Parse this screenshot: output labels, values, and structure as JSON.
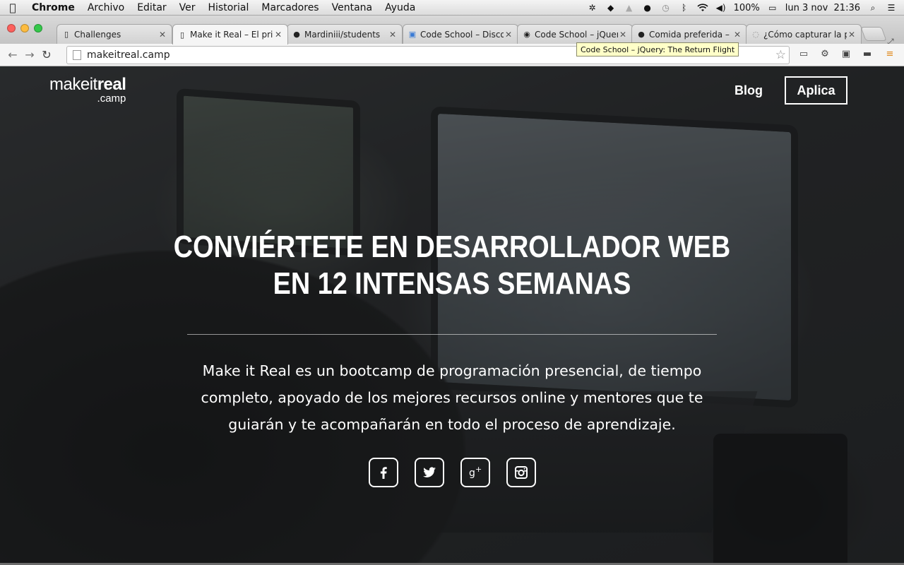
{
  "menubar": {
    "app": "Chrome",
    "items": [
      "Archivo",
      "Editar",
      "Ver",
      "Historial",
      "Marcadores",
      "Ventana",
      "Ayuda"
    ],
    "battery": "100%",
    "datetime": "lun 3 nov  21:36"
  },
  "tabs": [
    {
      "title": "Challenges",
      "icon": "page-icon"
    },
    {
      "title": "Make it Real – El prin",
      "icon": "page-icon",
      "active": true
    },
    {
      "title": "Mardiniii/students",
      "icon": "github-icon"
    },
    {
      "title": "Code School – Disco",
      "icon": "codeschool-icon"
    },
    {
      "title": "Code School – jQuer",
      "icon": "codeschool-icon"
    },
    {
      "title": "Comida preferida – S",
      "icon": "github-icon"
    },
    {
      "title": "¿Cómo capturar la p",
      "icon": "loading-icon"
    }
  ],
  "toolbar": {
    "url": "makeitreal.camp",
    "tooltip": "Code School – jQuery: The Return Flight"
  },
  "site": {
    "logo_main_light": "makeit",
    "logo_main_bold": "real",
    "logo_sub": ".camp",
    "nav_blog": "Blog",
    "nav_aplica": "Aplica",
    "hero_title_line1": "CONVIÉRTETE EN DESARROLLADOR WEB",
    "hero_title_line2": "EN 12 INTENSAS SEMANAS",
    "hero_text": "Make it Real es un bootcamp de programación presencial, de tiempo completo, apoyado de los mejores recursos online y mentores que te guiarán y te acompañarán en todo el proceso de aprendizaje.",
    "social": [
      "facebook-icon",
      "twitter-icon",
      "google-plus-icon",
      "instagram-icon"
    ]
  },
  "colors": {
    "tooltip_bg": "#ffffc8",
    "page_text": "#ffffff"
  }
}
